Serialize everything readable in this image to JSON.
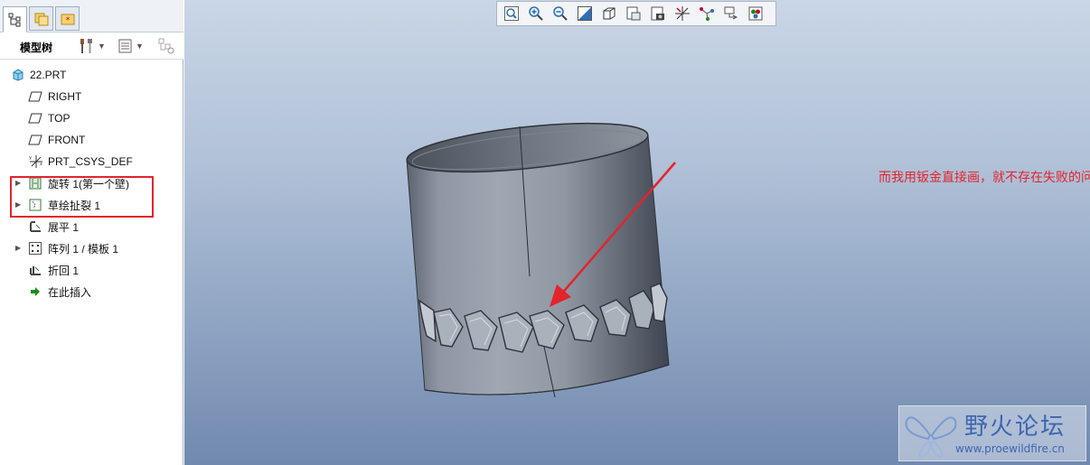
{
  "panel": {
    "tabs": [
      {
        "icon": "model-tree-icon"
      },
      {
        "icon": "folder-browser-icon"
      },
      {
        "icon": "favorites-icon"
      }
    ],
    "tree_title": "模型树"
  },
  "tree": {
    "items": [
      {
        "label": "22.PRT",
        "icon": "part-icon",
        "expandable": false
      },
      {
        "label": "RIGHT",
        "icon": "datum-plane-icon",
        "expandable": false
      },
      {
        "label": "TOP",
        "icon": "datum-plane-icon",
        "expandable": false
      },
      {
        "label": "FRONT",
        "icon": "datum-plane-icon",
        "expandable": false
      },
      {
        "label": "PRT_CSYS_DEF",
        "icon": "csys-icon",
        "expandable": false
      },
      {
        "label": "旋转 1(第一个壁)",
        "icon": "revolve-wall-icon",
        "expandable": true
      },
      {
        "label": "草绘扯裂 1",
        "icon": "sketched-rip-icon",
        "expandable": true
      },
      {
        "label": "展平 1",
        "icon": "unbend-icon",
        "expandable": false
      },
      {
        "label": "阵列 1 / 模板 1",
        "icon": "pattern-icon",
        "expandable": true
      },
      {
        "label": "折回 1",
        "icon": "bend-back-icon",
        "expandable": false
      },
      {
        "label": "在此插入",
        "icon": "insert-here-icon",
        "expandable": false
      }
    ]
  },
  "view_toolbar": {
    "buttons": [
      "zoom-fit-icon",
      "zoom-in-icon",
      "zoom-out-icon",
      "repaint-icon",
      "display-style-icon",
      "saved-views-icon",
      "layers-icon",
      "datum-display-icon",
      "spin-center-icon",
      "annotation-display-icon",
      "appearance-icon"
    ]
  },
  "annotation": {
    "text": "而我用钣金直接画，就不存在失败的问题"
  },
  "watermark": {
    "title": "野火论坛",
    "url": "www.proewildfire.cn"
  },
  "colors": {
    "highlight": "#e3242b",
    "annotation": "#e3242b",
    "watermark": "#3e65b0"
  }
}
